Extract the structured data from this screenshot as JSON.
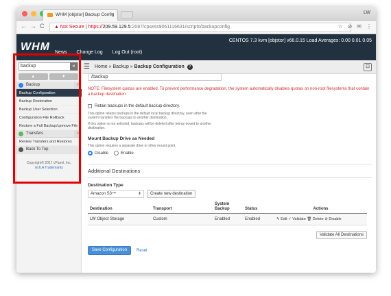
{
  "browser": {
    "tab_title": "WHM [objstor] Backup Config",
    "tab_close": "×",
    "user": "LW",
    "nav_back": "←",
    "nav_forward": "→",
    "nav_reload": "C",
    "url_warning": "▲ Not Secure",
    "url_separator": " | ",
    "url_scheme": "https://",
    "url_host": "209.59.129.5",
    "url_path": ":2087/cpsess9061116631/scripts/backupconfig",
    "toolbar_icons": [
      "☆",
      "⊘",
      "✉",
      "⋮"
    ]
  },
  "whm": {
    "logo": "WHM",
    "nav": [
      "News",
      "Change Log",
      "Log Out (root)"
    ],
    "system_info": "CENTOS 7.3 kvm [objstor]   v66.0.15   Load Averages: 0.00 0.01 0.05"
  },
  "sidebar": {
    "search_value": "backup",
    "search_clear": "×",
    "arrow_up": "▲",
    "arrow_down": "▼",
    "backup_heading": "Backup",
    "backup_items": [
      "Backup Configuration",
      "Backup Restoration",
      "Backup User Selection",
      "Configuration File Rollback",
      "Restore a Full Backup/cpmove File"
    ],
    "transfers_heading": "Transfers",
    "transfers_items": [
      "Review Transfers and Restores"
    ],
    "back_to_top": "Back To Top",
    "chevron": "∨",
    "copyright_line": "Copyright© 2017 cPanel, Inc.",
    "eula": "EULA",
    "trademarks": "Trademarks"
  },
  "breadcrumb": {
    "burger": "☰",
    "home": "Home",
    "sep": " » ",
    "section": "Backup",
    "current": "Backup Configuration",
    "help": "?",
    "expand": "⊡"
  },
  "form": {
    "path_value": "/backup",
    "quota_note": "NOTE: Filesystem quotas are enabled. To prevent performance degradation, the system automatically disables quotas on non-root filesystems that contain a backup destination.",
    "retain_label": "Retain backups in the default backup directory.",
    "retain_help1": "This option retains backups in the default local backup directory, even after the system transfers the backups to another destination.",
    "retain_help2": "If this option is not selected, backups will be deleted after being moved to another destination.",
    "mount_heading": "Mount Backup Drive as Needed",
    "mount_help": "This option requires a separate drive or other mount point.",
    "disable_label": "Disable",
    "enable_label": "Enable"
  },
  "destinations": {
    "heading": "Additional Destinations",
    "type_label": "Destination Type",
    "type_selected": "Amazon S3™",
    "type_caret": "⬍",
    "create_button": "Create new destination",
    "columns": [
      "Destination",
      "Transport",
      "System Backup",
      "Status",
      "Actions"
    ],
    "rows": [
      {
        "destination": "LW Object Storage",
        "transport": "Custom",
        "system_backup": "Enabled",
        "status": "Enabled"
      }
    ],
    "actions": {
      "edit": "✎ Edit",
      "validate": "✓ Validate",
      "delete": "🗑 Delete",
      "disable": "⊘ Disable"
    },
    "validate_all": "Validate All Destinations"
  },
  "footer": {
    "save": "Save Configuration",
    "reset": "Reset"
  },
  "colors": {
    "highlight_box": "#e10000",
    "whm_header": "#22313f",
    "primary": "#4a90d9"
  }
}
